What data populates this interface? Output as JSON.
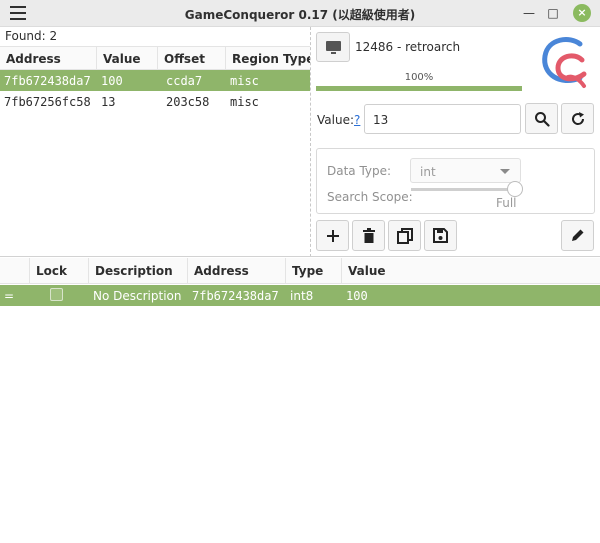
{
  "window": {
    "title": "GameConqueror 0.17 (以超級使用者)",
    "controls": {
      "minimize": "—",
      "maximize": "□",
      "close": "×"
    }
  },
  "found": {
    "label": "Found: 2"
  },
  "found_table": {
    "columns": [
      "Address",
      "Value",
      "Offset",
      "Region Type"
    ],
    "rows": [
      {
        "address": "7fb672438da7",
        "value": "100",
        "offset": "ccda7",
        "region": "misc",
        "selected": true
      },
      {
        "address": "7fb67256fc58",
        "value": "13",
        "offset": "203c58",
        "region": "misc",
        "selected": false
      }
    ]
  },
  "process": {
    "label": "12486 - retroarch",
    "icon": "monitor-icon"
  },
  "progress": {
    "label": "100%",
    "value": 1.0
  },
  "search": {
    "value_label": "Value:",
    "help_link": "?",
    "value": "13",
    "search_icon": "search-icon",
    "reset_icon": "refresh-icon"
  },
  "options": {
    "data_type_label": "Data Type:",
    "data_type_value": "int",
    "scope_label": "Search Scope:",
    "scope_value": "Full",
    "scope_level": 1.0
  },
  "toolbar": {
    "add_icon": "plus-icon",
    "delete_icon": "trash-icon",
    "copy_icon": "copy-icon",
    "save_icon": "save-icon",
    "edit_icon": "pencil-icon"
  },
  "cheat_table": {
    "columns": [
      "",
      "Lock",
      "Description",
      "Address",
      "Type",
      "Value"
    ],
    "rows": [
      {
        "marker": "=",
        "locked": false,
        "description": "No Description",
        "address": "7fb672438da7",
        "type": "int8",
        "value": "100"
      }
    ]
  },
  "colors": {
    "accent": "#8fb56a",
    "close_button": "#8bba5f",
    "link": "#2a6fd6"
  }
}
